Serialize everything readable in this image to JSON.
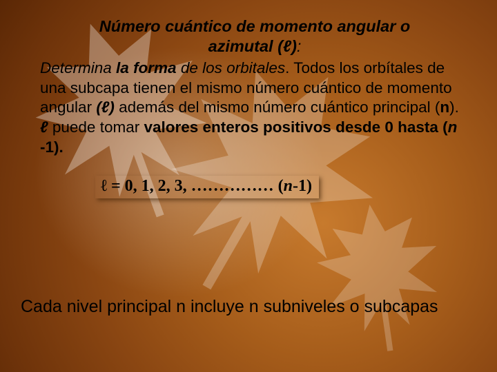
{
  "title_line1": "Número cuántico de momento angular o",
  "title_line2": "azimutal (ℓ)",
  "title_colon": ":",
  "body": {
    "s1": "Determina ",
    "s2": "la forma",
    "s3": " de los orbitales",
    "s4": ". Todos los orbítales de una subcapa tienen el mismo número cuántico de momento angular ",
    "s5": "(ℓ)",
    "s6": " además del mismo número cuántico principal (",
    "s7": "n",
    "s8": "). ",
    "s9": "ℓ",
    "s10": " puede tomar ",
    "s11": "valores enteros positivos desde 0 hasta (",
    "s12": "n ",
    "s13": "-1)."
  },
  "formula": {
    "lhs": "ℓ = 0, 1, 2, 3, …………… (",
    "n": "n",
    "rhs": "-1)"
  },
  "footer": "Cada nivel principal n incluye n subniveles o subcapas"
}
